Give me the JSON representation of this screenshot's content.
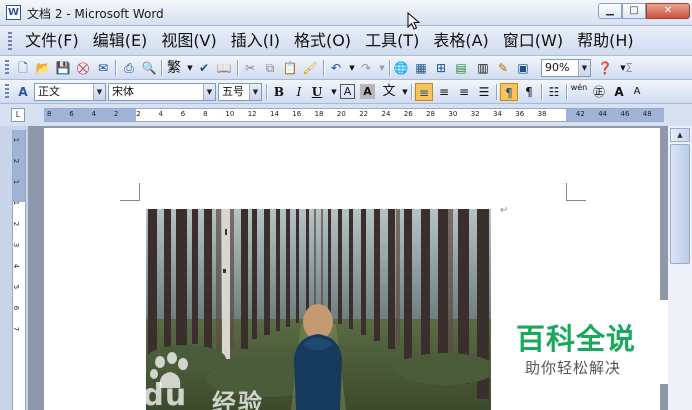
{
  "window": {
    "title": "文档 2 - Microsoft Word"
  },
  "menu": {
    "items": [
      {
        "label": "文件(F)",
        "name": "menu-file"
      },
      {
        "label": "编辑(E)",
        "name": "menu-edit"
      },
      {
        "label": "视图(V)",
        "name": "menu-view"
      },
      {
        "label": "插入(I)",
        "name": "menu-insert"
      },
      {
        "label": "格式(O)",
        "name": "menu-format"
      },
      {
        "label": "工具(T)",
        "name": "menu-tools"
      },
      {
        "label": "表格(A)",
        "name": "menu-table"
      },
      {
        "label": "窗口(W)",
        "name": "menu-window"
      },
      {
        "label": "帮助(H)",
        "name": "menu-help"
      }
    ]
  },
  "standard_toolbar": {
    "traditional_label": "繁",
    "zoom_value": "90%",
    "sigma": "Σ"
  },
  "formatting_toolbar": {
    "style_value": "正文",
    "font_value": "宋体",
    "size_value": "五号",
    "bold": "B",
    "italic": "I",
    "underline": "U",
    "font_color_label": "A",
    "shading_label": "A",
    "wen_label": "wén",
    "grow_font": "A",
    "shrink_font": "A"
  },
  "ruler": {
    "corner_label": "L",
    "ticks": [
      "8",
      "6",
      "4",
      "2",
      "2",
      "4",
      "6",
      "8",
      "10",
      "12",
      "14",
      "16",
      "18",
      "20",
      "22",
      "24",
      "26",
      "28",
      "30",
      "32",
      "34",
      "36",
      "38",
      "42",
      "44",
      "46",
      "48"
    ],
    "vticks": [
      "1",
      "2",
      "1",
      "1",
      "2",
      "3",
      "4",
      "5",
      "6",
      "7"
    ]
  },
  "document": {
    "paragraph_mark": "↵"
  },
  "watermark": {
    "baike_title": "百科全说",
    "baike_subtitle": "助你轻松解决",
    "baidu_text": "Baidu",
    "jingyan_text": "经验"
  },
  "colors": {
    "accent": "#2b579a",
    "baike_green": "#1aa85d",
    "toolbar_bg": "#d0dcf0"
  }
}
